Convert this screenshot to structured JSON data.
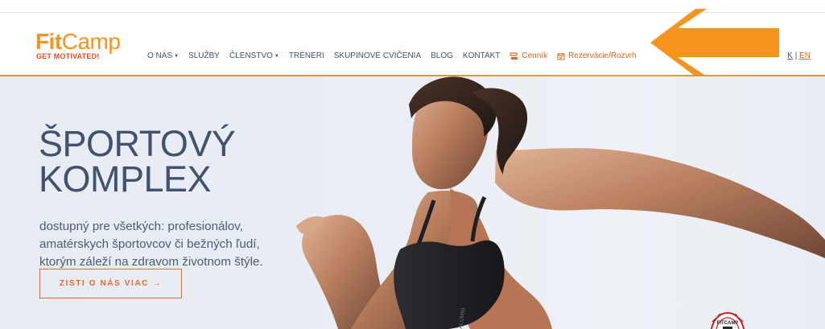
{
  "brand": {
    "logo_fit": "Fit",
    "logo_camp": "Camp",
    "tagline": "GET MOTIVATED!",
    "accent": "#f7941d",
    "accent_dark": "#e8641b",
    "text_color": "#45526e"
  },
  "nav": {
    "items": [
      {
        "label": "O NÁS",
        "has_dropdown": true
      },
      {
        "label": "SLUŽBY",
        "has_dropdown": false
      },
      {
        "label": "ČLENSTVO",
        "has_dropdown": true
      },
      {
        "label": "TRÉNERI",
        "has_dropdown": false
      },
      {
        "label": "SKUPINOVÉ CVIČENIA",
        "has_dropdown": false
      },
      {
        "label": "BLOG",
        "has_dropdown": false
      },
      {
        "label": "KONTAKT",
        "has_dropdown": false
      }
    ],
    "pricing_label": "Cenník",
    "pricing_icon": "money-icon",
    "reservation_label": "Rezervácie/Rozvrh",
    "reservation_icon": "calendar-check-icon"
  },
  "language": {
    "sk": "K",
    "separator": "|",
    "en": "EN"
  },
  "overlay": {
    "arrow_color": "#f7941d",
    "arrow_icon": "left-arrow-icon"
  },
  "hero": {
    "title": "ŠPORTOVÝ\nKOMPLEX",
    "description": "dostupný pre všetkých: profesionálov, amatérskych športovcov či bežných ľudí, ktorým záleží na zdravom životnom štýle.",
    "cta_label": "ZISTI O NÁS VIAC →",
    "badge_text": "FITCAMP"
  }
}
